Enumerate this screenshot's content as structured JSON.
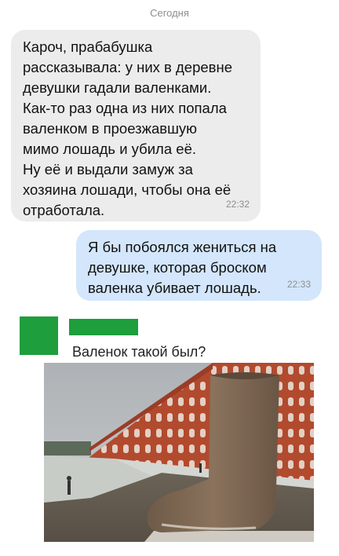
{
  "chat": {
    "date_divider": "Сегодня",
    "messages": [
      {
        "direction": "incoming",
        "lines": [
          "Кароч, прабабушка",
          "рассказывала: у них в деревне",
          "девушки гадали валенками.",
          "Как-то раз одна из них попала",
          "валенком в проезжавшую",
          "мимо лошадь и убила её.",
          "Ну её и выдали замуж за",
          "хозяина лошади, чтобы она её",
          "отработала."
        ],
        "time": "22:32"
      },
      {
        "direction": "outgoing",
        "lines": [
          "Я бы побоялся жениться на",
          "девушке, которая броском",
          "валенка убивает лошадь."
        ],
        "time": "22:33"
      }
    ]
  },
  "comment": {
    "text": "Валенок такой был?",
    "colors": {
      "avatar_fill": "#1e9e3c",
      "name_redaction": "#1e9e3c"
    },
    "photo_subject": "giant felt boot sculpture beside red brick building"
  },
  "colors": {
    "incoming_bubble": "#ececec",
    "outgoing_bubble": "#d3e6fb",
    "timestamp": "#8e8e93"
  }
}
